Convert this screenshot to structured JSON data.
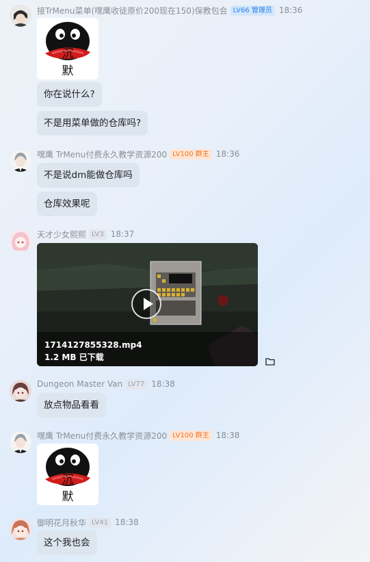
{
  "messages": [
    {
      "name": "接TrMenu菜单(嘿鹰收徒原价200现在150)保教包会",
      "badge": "LV66 管理员",
      "time": "18:36",
      "sticker_caption": "沉 默",
      "bubbles": [
        "你在说什么?",
        "不是用菜单做的仓库吗?"
      ]
    },
    {
      "name": "嘿鹰 TrMenu付费永久教学资源200",
      "badge": "LV100 群主",
      "time": "18:36",
      "bubbles": [
        "不是说dm能做仓库吗",
        "仓库效果呢"
      ]
    },
    {
      "name": "天才少女熙熙",
      "badge": "LV3",
      "time": "18:37",
      "video": {
        "filename": "1714127855328.mp4",
        "size": "1.2 MB 已下载"
      }
    },
    {
      "name": "Dungeon Master Van",
      "badge": "LV77",
      "time": "18:38",
      "bubbles": [
        "放点物品看看"
      ]
    },
    {
      "name": "嘿鹰 TrMenu付费永久教学资源200",
      "badge": "LV100 群主",
      "time": "18:38",
      "sticker_caption": "沉 默"
    },
    {
      "name": "御明花月秋华",
      "badge": "LV41",
      "time": "18:38",
      "bubbles": [
        "这个我也会"
      ]
    }
  ],
  "icons": {
    "folder": "folder-icon",
    "play": "play-icon"
  },
  "colors": {
    "admin_badge": "#2b83e8",
    "owner_badge": "#f2731f"
  }
}
